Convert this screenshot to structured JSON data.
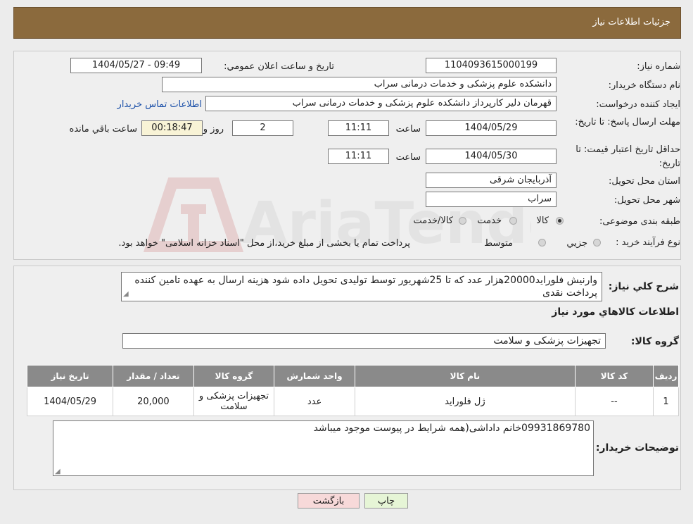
{
  "header": {
    "title": "جزئیات اطلاعات نیاز"
  },
  "fields": {
    "need_number_label": "شماره نیاز:",
    "need_number": "1104093615000199",
    "announce_label": "تاریخ و ساعت اعلان عمومي:",
    "announce_value": "1404/05/27 - 09:49",
    "buyer_label": "نام دستگاه خریدار:",
    "buyer_value": "دانشکده علوم پزشکی و خدمات درمانی سراب",
    "creator_label": "ایجاد کننده درخواست:",
    "creator_value": "قهرمان دلیر کارپرداز دانشکده علوم پزشکی و خدمات درمانی سراب",
    "contact_link": "اطلاعات تماس خریدار",
    "deadline_label": "مهلت ارسال پاسخ: تا تاریخ:",
    "deadline_date": "1404/05/29",
    "time_label": "ساعت",
    "deadline_time": "11:11",
    "days_value": "2",
    "days_label": "روز و",
    "remaining_time": "00:18:47",
    "remaining_label": "ساعت باقي مانده",
    "validity_label": "حداقل تاریخ اعتبار قیمت: تا تاریخ:",
    "validity_date": "1404/05/30",
    "validity_time": "11:11",
    "province_label": "استان محل تحویل:",
    "province_value": "آذربایجان شرقی",
    "city_label": "شهر محل تحویل:",
    "city_value": "سراب",
    "category_label": "طبقه بندی موضوعی:",
    "category_options": [
      "کالا",
      "خدمت",
      "کالا/خدمت"
    ],
    "category_selected": "کالا",
    "purchase_label": "نوع فرآیند خرید :",
    "purchase_options": [
      "جزيي",
      "متوسط"
    ],
    "purchase_note": "پرداخت تمام یا بخشی از مبلغ خرید،از محل \"اسناد خزانه اسلامی\" خواهد بود."
  },
  "description": {
    "label": "شرح کلي نياز:",
    "text": "وارنیش فلوراید20000هزار عدد که تا 25شهریور توسط تولیدی تحویل داده شود هزینه ارسال به عهده تامین کننده پرداخت نقدی"
  },
  "goods": {
    "section_title": "اطلاعات کالاهاي مورد نياز",
    "group_label": "گروه کالا:",
    "group_value": "تجهیزات پزشکی و سلامت",
    "columns": [
      "ردیف",
      "کد کالا",
      "نام کالا",
      "واحد شمارش",
      "گروه کالا",
      "تعداد / مقدار",
      "تاریخ نیاز"
    ],
    "rows": [
      {
        "row": "1",
        "code": "--",
        "name": "ژل فلوراید",
        "unit": "عدد",
        "group": "تجهیزات پزشکی و سلامت",
        "qty": "20,000",
        "date": "1404/05/29"
      }
    ]
  },
  "buyer_notes": {
    "label": "توضیحات خریدار:",
    "text": "09931869780خانم داداشی(همه شرایط در پیوست موجود میباشد"
  },
  "buttons": {
    "print": "چاپ",
    "back": "بازگشت"
  },
  "watermark": {
    "text": "AriaTender.neT"
  },
  "colors": {
    "header": "#8b6a3d",
    "table_header": "#8a8a8a",
    "print_btn": "#e6f5d6",
    "back_btn": "#f7d9d9"
  }
}
